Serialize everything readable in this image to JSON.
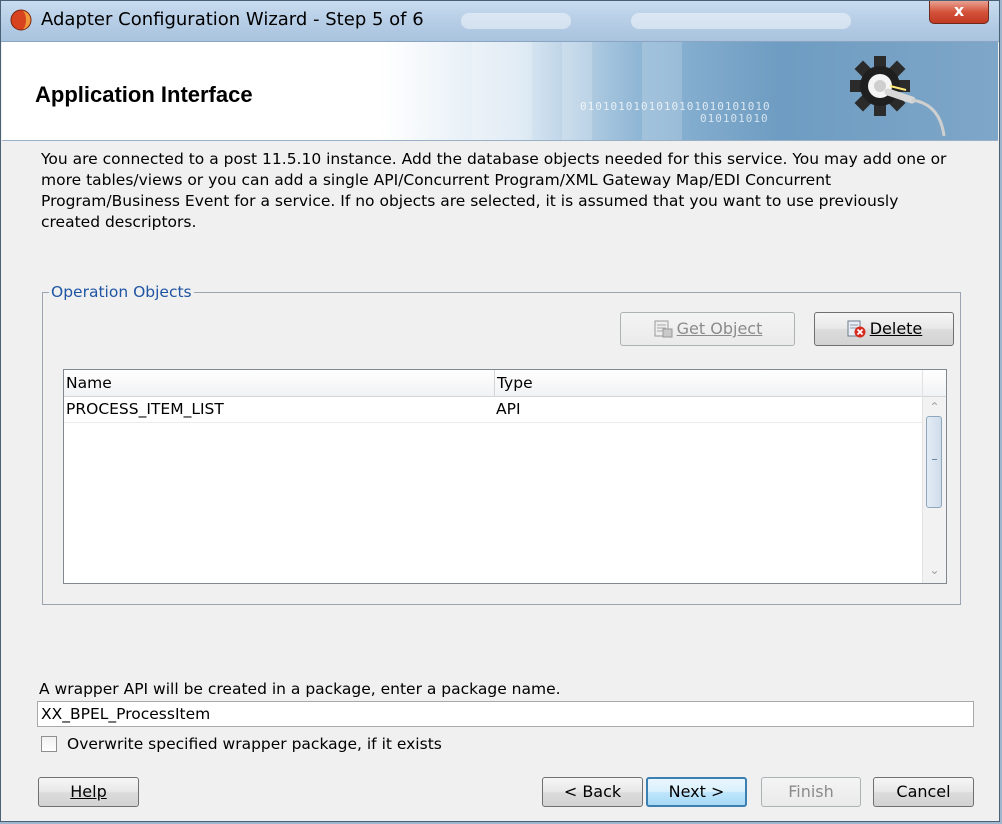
{
  "window": {
    "title": "Adapter Configuration Wizard - Step 5 of 6",
    "close_label": "x"
  },
  "banner": {
    "heading": "Application Interface",
    "binary_text": "0101010101010101010101010",
    "binary_text_2": "010101010"
  },
  "description": "You are connected to a post 11.5.10 instance. Add the database objects needed for this service. You may add one or more tables/views or you can add a single API/Concurrent Program/XML Gateway Map/EDI Concurrent Program/Business Event for a service. If no objects are selected, it is assumed that you want to use previously created descriptors.",
  "operation_objects": {
    "group_label": "Operation Objects",
    "get_object_label": "Get Object",
    "delete_label": "Delete",
    "columns": [
      "Name",
      "Type"
    ],
    "rows": [
      {
        "name": "PROCESS_ITEM_LIST",
        "type": "API"
      }
    ]
  },
  "package": {
    "label": "A wrapper API will be created in a package, enter a package name.",
    "value": "XX_BPEL_ProcessItem",
    "overwrite_label": "Overwrite specified wrapper package, if it exists",
    "overwrite_checked": false
  },
  "footer": {
    "help_label": "Help",
    "back_label": "< Back",
    "next_label": "Next >",
    "finish_label": "Finish",
    "cancel_label": "Cancel"
  },
  "colors": {
    "group_label": "#1f55a3",
    "title_bar": "#b8cfe7",
    "close_button": "#c23a22"
  }
}
